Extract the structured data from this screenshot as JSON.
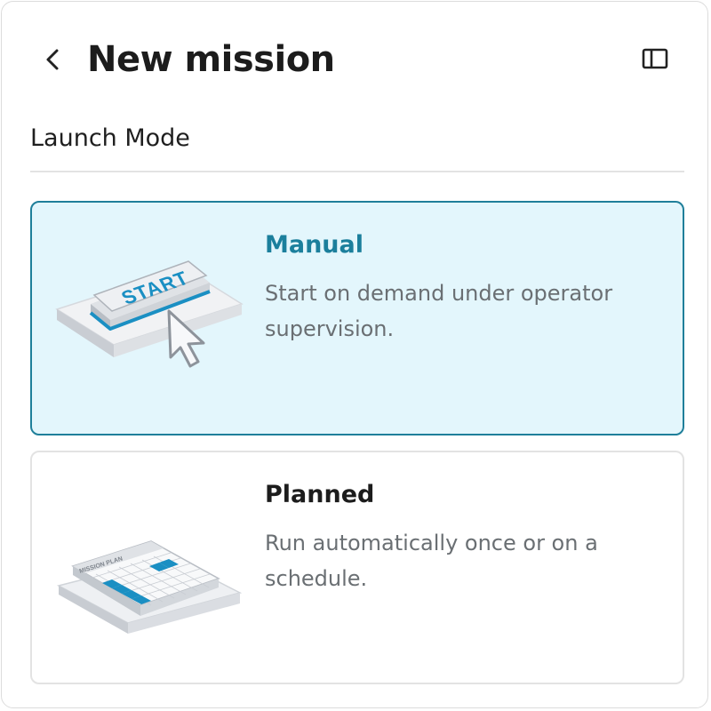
{
  "header": {
    "back_icon": "chevron-left-icon",
    "title": "New mission",
    "panel_icon": "sidebar-panel-icon"
  },
  "section": {
    "title": "Launch Mode"
  },
  "options": [
    {
      "title": "Manual",
      "description": "Start on demand under operator supervision.",
      "selected": true,
      "illustration_text": "START",
      "illustration_icon": "start-button-cursor-icon"
    },
    {
      "title": "Planned",
      "description": "Run automatically once or on a schedule.",
      "selected": false,
      "illustration_text": "MISSION PLAN",
      "illustration_icon": "calendar-schedule-icon"
    }
  ],
  "colors": {
    "accent": "#1b7f9c",
    "selected_background": "#e3f6fc",
    "selected_border": "#1f7f9a",
    "calendar_highlight": "#1a8fc3"
  }
}
